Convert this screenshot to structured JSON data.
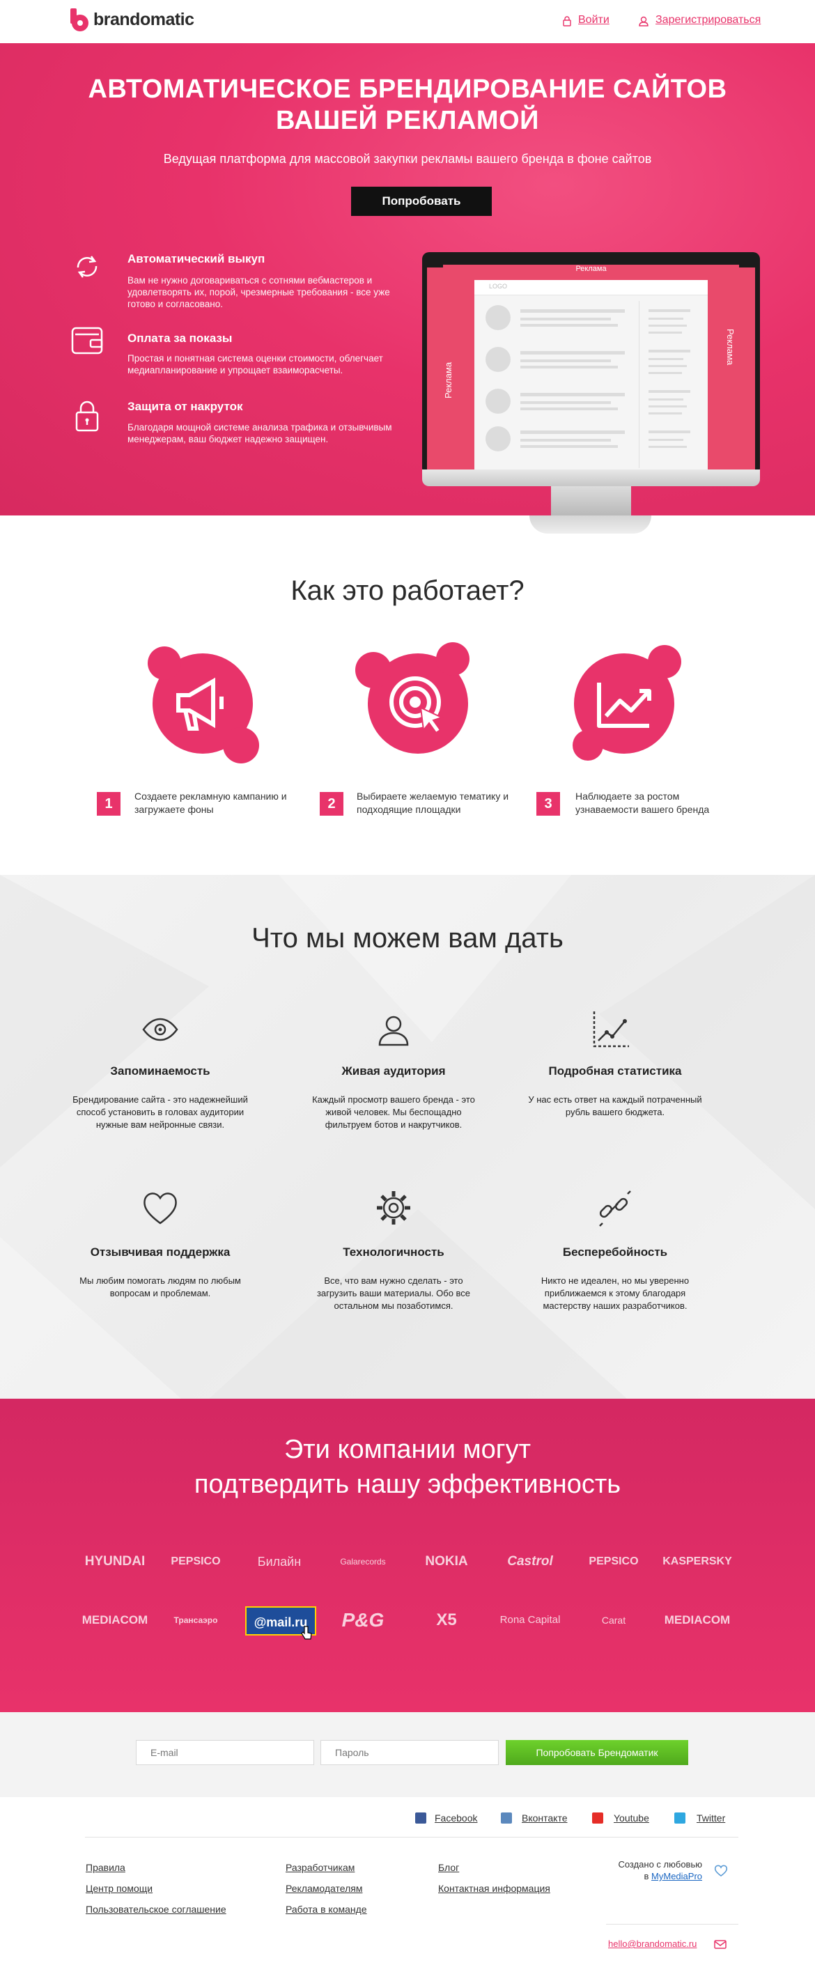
{
  "header": {
    "brand": "brandomatic",
    "login": "Войти",
    "register": "Зарегистрироваться"
  },
  "hero": {
    "title_line1": "АВТОМАТИЧЕСКОЕ БРЕНДИРОВАНИЕ САЙТОВ",
    "title_line2": "ВАШЕЙ РЕКЛАМОЙ",
    "subtitle": "Ведущая платформа для массовой закупки рекламы вашего бренда в фоне сайтов",
    "cta": "Попробовать",
    "features": [
      {
        "title": "Автоматический выкуп",
        "text": "Вам не нужно договариваться с сотнями вебмастеров и удовлетворять их, порой, чрезмерные требования - все уже готово и согласовано.",
        "icon": "refresh-icon"
      },
      {
        "title": "Оплата за показы",
        "text": "Простая и понятная система оценки стоимости, облегчает медиапланирование и упрощает взаиморасчеты.",
        "icon": "wallet-icon"
      },
      {
        "title": "Защита от накруток",
        "text": "Благодаря мощной системе анализа трафика и отзывчивым менеджерам, ваш бюджет надежно защищен.",
        "icon": "lock-icon"
      }
    ],
    "monitor": {
      "top_label": "Реклама",
      "left_label": "Реклама",
      "right_label": "Реклама",
      "logo": "LOGO"
    }
  },
  "how": {
    "title": "Как это работает?",
    "steps": [
      {
        "num": "1",
        "text": "Создаете рекламную кампанию и загружаете фоны",
        "icon": "megaphone-icon"
      },
      {
        "num": "2",
        "text": "Выбираете желаемую тематику и подходящие площадки",
        "icon": "target-icon"
      },
      {
        "num": "3",
        "text": "Наблюдаете за ростом узнаваемости вашего бренда",
        "icon": "chart-up-icon"
      }
    ]
  },
  "give": {
    "title": "Что мы можем вам дать",
    "items": [
      {
        "title": "Запоминаемость",
        "text": "Брендирование сайта - это надежнейший способ установить в головах аудитории нужные вам нейронные связи.",
        "icon": "eye-icon"
      },
      {
        "title": "Живая аудитория",
        "text": "Каждый просмотр вашего бренда - это живой человек. Мы беспощадно фильтруем ботов и накрутчиков.",
        "icon": "user-icon"
      },
      {
        "title": "Подробная статистика",
        "text": "У нас есть ответ на каждый потраченный рубль вашего бюджета.",
        "icon": "stats-icon"
      },
      {
        "title": "Отзывчивая поддержка",
        "text": "Мы любим помогать людям по любым вопросам и проблемам.",
        "icon": "heart-icon"
      },
      {
        "title": "Технологичность",
        "text": "Все, что вам нужно сделать - это загрузить ваши материалы. Обо все остальном мы позаботимся.",
        "icon": "gear-icon"
      },
      {
        "title": "Бесперебойность",
        "text": "Никто не идеален, но мы уверенно приближаемся к этому благодаря мастерству наших разработчиков.",
        "icon": "chain-icon"
      }
    ]
  },
  "partners": {
    "title_line1": "Эти компании могут",
    "title_line2": "подтвердить нашу эффективность",
    "row1": [
      "HYUNDAI",
      "PEPSICO",
      "Билайн",
      "Galarecords",
      "NOKIA",
      "Castrol",
      "PEPSICO",
      "KASPERSKY"
    ],
    "row2": [
      "MEDIACOM",
      "Трансаэро",
      "@mail.ru",
      "P&G",
      "X5",
      "Rona Capital",
      "Carat",
      "MEDIACOM"
    ]
  },
  "signup": {
    "email_placeholder": "E-mail",
    "password_placeholder": "Пароль",
    "submit": "Попробовать Брендоматик"
  },
  "footer": {
    "social": [
      "Facebook",
      "Вконтакте",
      "Youtube",
      "Twitter"
    ],
    "col1": [
      "Правила",
      "Центр помощи",
      "Пользовательское соглашение"
    ],
    "col2": [
      "Разработчикам",
      "Рекламодателям",
      "Работа в команде"
    ],
    "col3": [
      "Блог",
      "Контактная информация"
    ],
    "made_by": "Создано с любовью",
    "made_by_prefix": "в",
    "made_by_link": "MyMediaPro",
    "email": "hello@brandomatic.ru"
  },
  "colors": {
    "brand_pink": "#e8336a",
    "dark": "#111111",
    "green": "#5cbe23"
  }
}
